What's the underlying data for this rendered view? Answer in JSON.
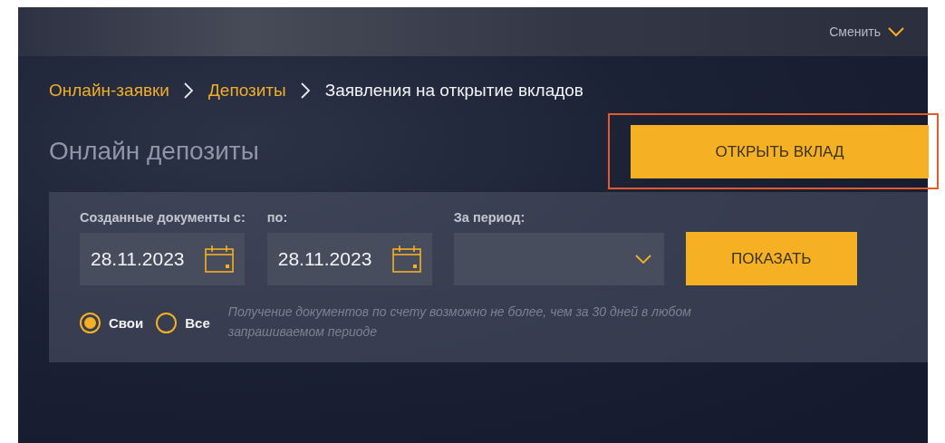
{
  "top_bar": {
    "switch_label": "Сменить"
  },
  "breadcrumbs": [
    {
      "label": "Онлайн-заявки",
      "kind": "link"
    },
    {
      "label": "Депозиты",
      "kind": "link"
    },
    {
      "label": "Заявления на открытие вкладов",
      "kind": "current"
    }
  ],
  "page_title": "Онлайн депозиты",
  "open_button": "ОТКРЫТЬ ВКЛАД",
  "filter": {
    "date_from": {
      "label": "Созданные документы с:",
      "value": "28.11.2023"
    },
    "date_to": {
      "label": "по:",
      "value": "28.11.2023"
    },
    "period": {
      "label": "За период:"
    },
    "show_button": "ПОКАЗАТЬ",
    "scope": [
      {
        "label": "Свои",
        "selected": true
      },
      {
        "label": "Все",
        "selected": false
      }
    ],
    "hint": "Получение документов по счету возможно не более, чем за 30 дней в любом запрашиваемом периоде"
  }
}
